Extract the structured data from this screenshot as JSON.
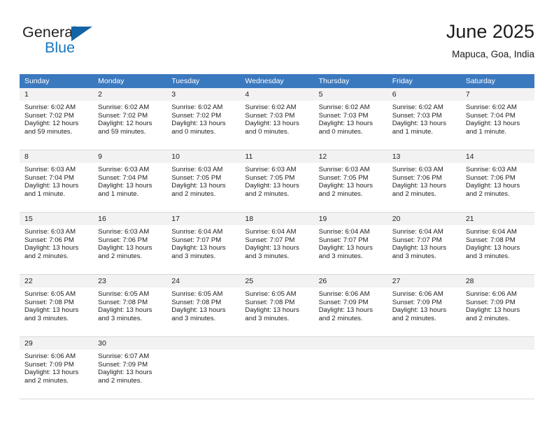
{
  "logo": {
    "word_top": "General",
    "word_bottom": "Blue",
    "triangle_color": "#1464a5",
    "blue_color": "#1878bd"
  },
  "header": {
    "title": "June 2025",
    "subtitle": "Mapuca, Goa, India"
  },
  "theme": {
    "header_row_bg": "#3b79bf",
    "daynum_bg": "#f2f2f2",
    "grid_line": "#d9d9d9",
    "text": "#222222"
  },
  "weekdays": [
    "Sunday",
    "Monday",
    "Tuesday",
    "Wednesday",
    "Thursday",
    "Friday",
    "Saturday"
  ],
  "weeks": [
    {
      "days": [
        {
          "num": "1",
          "sunrise": "Sunrise: 6:02 AM",
          "sunset": "Sunset: 7:02 PM",
          "daylight1": "Daylight: 12 hours",
          "daylight2": "and 59 minutes."
        },
        {
          "num": "2",
          "sunrise": "Sunrise: 6:02 AM",
          "sunset": "Sunset: 7:02 PM",
          "daylight1": "Daylight: 12 hours",
          "daylight2": "and 59 minutes."
        },
        {
          "num": "3",
          "sunrise": "Sunrise: 6:02 AM",
          "sunset": "Sunset: 7:02 PM",
          "daylight1": "Daylight: 13 hours",
          "daylight2": "and 0 minutes."
        },
        {
          "num": "4",
          "sunrise": "Sunrise: 6:02 AM",
          "sunset": "Sunset: 7:03 PM",
          "daylight1": "Daylight: 13 hours",
          "daylight2": "and 0 minutes."
        },
        {
          "num": "5",
          "sunrise": "Sunrise: 6:02 AM",
          "sunset": "Sunset: 7:03 PM",
          "daylight1": "Daylight: 13 hours",
          "daylight2": "and 0 minutes."
        },
        {
          "num": "6",
          "sunrise": "Sunrise: 6:02 AM",
          "sunset": "Sunset: 7:03 PM",
          "daylight1": "Daylight: 13 hours",
          "daylight2": "and 1 minute."
        },
        {
          "num": "7",
          "sunrise": "Sunrise: 6:02 AM",
          "sunset": "Sunset: 7:04 PM",
          "daylight1": "Daylight: 13 hours",
          "daylight2": "and 1 minute."
        }
      ]
    },
    {
      "days": [
        {
          "num": "8",
          "sunrise": "Sunrise: 6:03 AM",
          "sunset": "Sunset: 7:04 PM",
          "daylight1": "Daylight: 13 hours",
          "daylight2": "and 1 minute."
        },
        {
          "num": "9",
          "sunrise": "Sunrise: 6:03 AM",
          "sunset": "Sunset: 7:04 PM",
          "daylight1": "Daylight: 13 hours",
          "daylight2": "and 1 minute."
        },
        {
          "num": "10",
          "sunrise": "Sunrise: 6:03 AM",
          "sunset": "Sunset: 7:05 PM",
          "daylight1": "Daylight: 13 hours",
          "daylight2": "and 2 minutes."
        },
        {
          "num": "11",
          "sunrise": "Sunrise: 6:03 AM",
          "sunset": "Sunset: 7:05 PM",
          "daylight1": "Daylight: 13 hours",
          "daylight2": "and 2 minutes."
        },
        {
          "num": "12",
          "sunrise": "Sunrise: 6:03 AM",
          "sunset": "Sunset: 7:05 PM",
          "daylight1": "Daylight: 13 hours",
          "daylight2": "and 2 minutes."
        },
        {
          "num": "13",
          "sunrise": "Sunrise: 6:03 AM",
          "sunset": "Sunset: 7:06 PM",
          "daylight1": "Daylight: 13 hours",
          "daylight2": "and 2 minutes."
        },
        {
          "num": "14",
          "sunrise": "Sunrise: 6:03 AM",
          "sunset": "Sunset: 7:06 PM",
          "daylight1": "Daylight: 13 hours",
          "daylight2": "and 2 minutes."
        }
      ]
    },
    {
      "days": [
        {
          "num": "15",
          "sunrise": "Sunrise: 6:03 AM",
          "sunset": "Sunset: 7:06 PM",
          "daylight1": "Daylight: 13 hours",
          "daylight2": "and 2 minutes."
        },
        {
          "num": "16",
          "sunrise": "Sunrise: 6:03 AM",
          "sunset": "Sunset: 7:06 PM",
          "daylight1": "Daylight: 13 hours",
          "daylight2": "and 2 minutes."
        },
        {
          "num": "17",
          "sunrise": "Sunrise: 6:04 AM",
          "sunset": "Sunset: 7:07 PM",
          "daylight1": "Daylight: 13 hours",
          "daylight2": "and 3 minutes."
        },
        {
          "num": "18",
          "sunrise": "Sunrise: 6:04 AM",
          "sunset": "Sunset: 7:07 PM",
          "daylight1": "Daylight: 13 hours",
          "daylight2": "and 3 minutes."
        },
        {
          "num": "19",
          "sunrise": "Sunrise: 6:04 AM",
          "sunset": "Sunset: 7:07 PM",
          "daylight1": "Daylight: 13 hours",
          "daylight2": "and 3 minutes."
        },
        {
          "num": "20",
          "sunrise": "Sunrise: 6:04 AM",
          "sunset": "Sunset: 7:07 PM",
          "daylight1": "Daylight: 13 hours",
          "daylight2": "and 3 minutes."
        },
        {
          "num": "21",
          "sunrise": "Sunrise: 6:04 AM",
          "sunset": "Sunset: 7:08 PM",
          "daylight1": "Daylight: 13 hours",
          "daylight2": "and 3 minutes."
        }
      ]
    },
    {
      "days": [
        {
          "num": "22",
          "sunrise": "Sunrise: 6:05 AM",
          "sunset": "Sunset: 7:08 PM",
          "daylight1": "Daylight: 13 hours",
          "daylight2": "and 3 minutes."
        },
        {
          "num": "23",
          "sunrise": "Sunrise: 6:05 AM",
          "sunset": "Sunset: 7:08 PM",
          "daylight1": "Daylight: 13 hours",
          "daylight2": "and 3 minutes."
        },
        {
          "num": "24",
          "sunrise": "Sunrise: 6:05 AM",
          "sunset": "Sunset: 7:08 PM",
          "daylight1": "Daylight: 13 hours",
          "daylight2": "and 3 minutes."
        },
        {
          "num": "25",
          "sunrise": "Sunrise: 6:05 AM",
          "sunset": "Sunset: 7:08 PM",
          "daylight1": "Daylight: 13 hours",
          "daylight2": "and 3 minutes."
        },
        {
          "num": "26",
          "sunrise": "Sunrise: 6:06 AM",
          "sunset": "Sunset: 7:09 PM",
          "daylight1": "Daylight: 13 hours",
          "daylight2": "and 2 minutes."
        },
        {
          "num": "27",
          "sunrise": "Sunrise: 6:06 AM",
          "sunset": "Sunset: 7:09 PM",
          "daylight1": "Daylight: 13 hours",
          "daylight2": "and 2 minutes."
        },
        {
          "num": "28",
          "sunrise": "Sunrise: 6:06 AM",
          "sunset": "Sunset: 7:09 PM",
          "daylight1": "Daylight: 13 hours",
          "daylight2": "and 2 minutes."
        }
      ]
    },
    {
      "days": [
        {
          "num": "29",
          "sunrise": "Sunrise: 6:06 AM",
          "sunset": "Sunset: 7:09 PM",
          "daylight1": "Daylight: 13 hours",
          "daylight2": "and 2 minutes."
        },
        {
          "num": "30",
          "sunrise": "Sunrise: 6:07 AM",
          "sunset": "Sunset: 7:09 PM",
          "daylight1": "Daylight: 13 hours",
          "daylight2": "and 2 minutes."
        },
        {
          "num": "",
          "sunrise": "",
          "sunset": "",
          "daylight1": "",
          "daylight2": ""
        },
        {
          "num": "",
          "sunrise": "",
          "sunset": "",
          "daylight1": "",
          "daylight2": ""
        },
        {
          "num": "",
          "sunrise": "",
          "sunset": "",
          "daylight1": "",
          "daylight2": ""
        },
        {
          "num": "",
          "sunrise": "",
          "sunset": "",
          "daylight1": "",
          "daylight2": ""
        },
        {
          "num": "",
          "sunrise": "",
          "sunset": "",
          "daylight1": "",
          "daylight2": ""
        }
      ]
    }
  ]
}
